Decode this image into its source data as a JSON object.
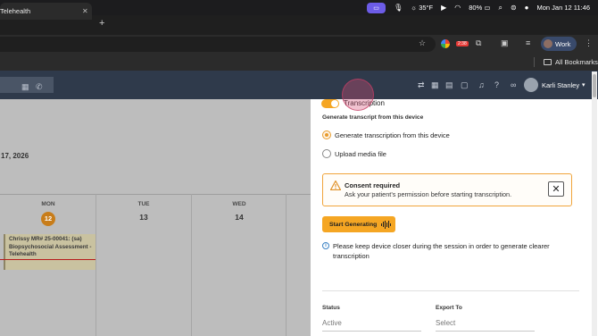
{
  "menubar": {
    "weather": "35°F",
    "battery": "80%",
    "datetime": "Mon Jan 12  11:46"
  },
  "browser": {
    "tab_title": "Telehealth",
    "profile_label": "Work",
    "all_bookmarks": "All Bookmarks",
    "extension_badge": "2:38"
  },
  "app": {
    "user_name": "Karli Stanley"
  },
  "calendar": {
    "date_heading": "17, 2026",
    "days": [
      {
        "label": "MON",
        "num": "12"
      },
      {
        "label": "TUE",
        "num": "13"
      },
      {
        "label": "WED",
        "num": "14"
      }
    ],
    "event_text": "Chrissy MR# 25-00041: (sa) Biopsychosocial Assessment - Telehealth"
  },
  "panel": {
    "toggle_label": "Transcription",
    "section_title": "Generate transcript from this device",
    "options": [
      {
        "label": "Generate transcription from this device",
        "selected": true
      },
      {
        "label": "Upload media file",
        "selected": false
      }
    ],
    "consent_title": "Consent required",
    "consent_body": "Ask your patient's permission before starting transcription.",
    "start_button": "Start Generating",
    "info_text": "Please keep device closer during the session in order to generate clearer transcription",
    "status_label": "Status",
    "status_value": "Active",
    "export_label": "Export To",
    "export_value": "Select"
  }
}
